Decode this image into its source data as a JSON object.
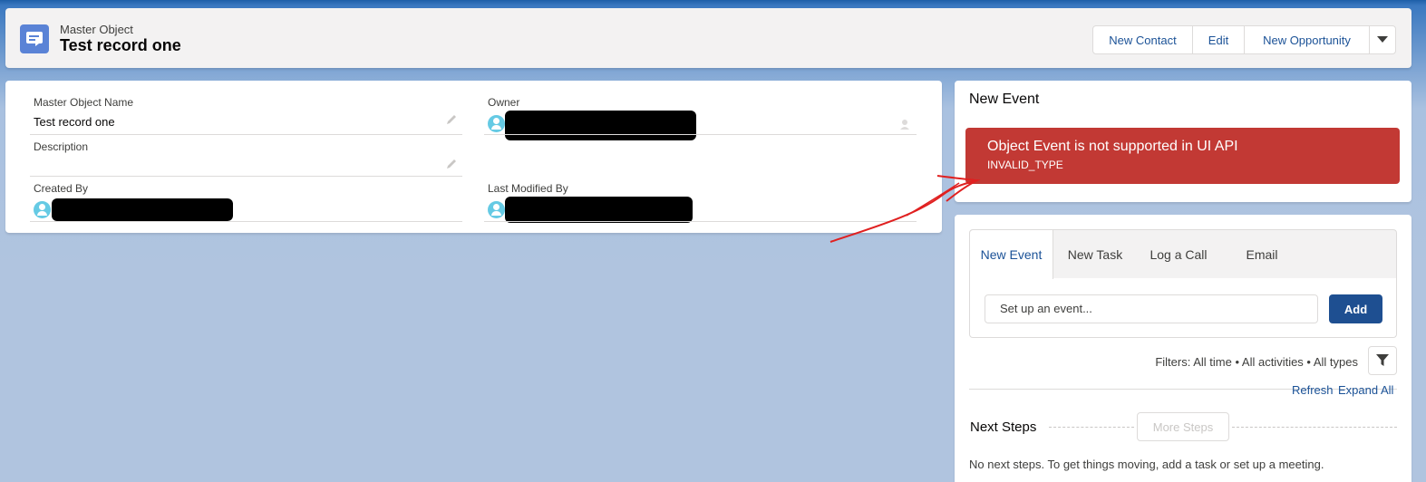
{
  "header": {
    "object_type": "Master Object",
    "record_title": "Test record one",
    "icon": "record-icon",
    "actions": [
      "New Contact",
      "Edit",
      "New Opportunity"
    ],
    "more_actions_icon": "chevron-down-icon"
  },
  "details": {
    "name_label": "Master Object Name",
    "name_value": "Test record one",
    "owner_label": "Owner",
    "description_label": "Description",
    "description_value": "",
    "created_by_label": "Created By",
    "last_modified_label": "Last Modified By"
  },
  "event_card": {
    "title": "New Event",
    "error_message": "Object Event is not supported in UI API",
    "error_code": "INVALID_TYPE"
  },
  "activity": {
    "tabs": [
      "New Event",
      "New Task",
      "Log a Call",
      "Email"
    ],
    "input_placeholder": "Set up an event...",
    "add_label": "Add",
    "filters": "Filters: All time • All activities • All types",
    "refresh": "Refresh",
    "expand_all": "Expand All",
    "next_steps": "Next Steps",
    "more_steps": "More Steps",
    "empty_message": "No next steps. To get things moving, add a task or set up a meeting."
  },
  "colors": {
    "brand_blue": "#1b5297",
    "error_red": "#c23934",
    "background": "#b0c4df"
  }
}
